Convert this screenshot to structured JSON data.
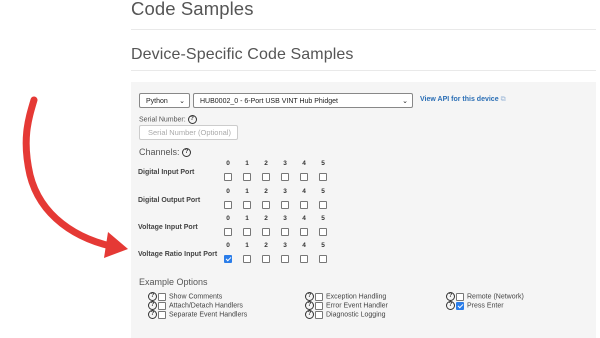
{
  "page": {
    "title": "Code Samples",
    "subtitle": "Device-Specific Code Samples"
  },
  "selectors": {
    "language": "Python",
    "device": "HUB0002_0 - 6-Port USB VINT Hub Phidget",
    "api_link": "View API for this device"
  },
  "serial": {
    "label": "Serial Number:",
    "placeholder": "Serial Number (Optional)"
  },
  "channels": {
    "label": "Channels:",
    "rows": [
      {
        "name": "Digital Input Port",
        "ports": [
          "0",
          "1",
          "2",
          "3",
          "4",
          "5"
        ],
        "checked": [
          false,
          false,
          false,
          false,
          false,
          false
        ]
      },
      {
        "name": "Digital Output Port",
        "ports": [
          "0",
          "1",
          "2",
          "3",
          "4",
          "5"
        ],
        "checked": [
          false,
          false,
          false,
          false,
          false,
          false
        ]
      },
      {
        "name": "Voltage Input Port",
        "ports": [
          "0",
          "1",
          "2",
          "3",
          "4",
          "5"
        ],
        "checked": [
          false,
          false,
          false,
          false,
          false,
          false
        ]
      },
      {
        "name": "Voltage Ratio Input Port",
        "ports": [
          "0",
          "1",
          "2",
          "3",
          "4",
          "5"
        ],
        "checked": [
          true,
          false,
          false,
          false,
          false,
          false
        ]
      }
    ]
  },
  "example_options": {
    "label": "Example Options",
    "items": [
      {
        "label": "Show Comments",
        "checked": false
      },
      {
        "label": "Attach/Detach Handlers",
        "checked": false
      },
      {
        "label": "Separate Event Handlers",
        "checked": false
      },
      {
        "label": "Exception Handling",
        "checked": false
      },
      {
        "label": "Error Event Handler",
        "checked": false
      },
      {
        "label": "Diagnostic Logging",
        "checked": false
      },
      {
        "label": "Remote (Network)",
        "checked": false
      },
      {
        "label": "Press Enter",
        "checked": true
      }
    ]
  },
  "colors": {
    "accent": "#2b7de9",
    "link": "#2a6eb5",
    "annotation_arrow": "#e53935"
  },
  "icons": {
    "help": "question-circle-icon",
    "external": "external-link-icon",
    "dropdown": "chevron-down-icon"
  }
}
